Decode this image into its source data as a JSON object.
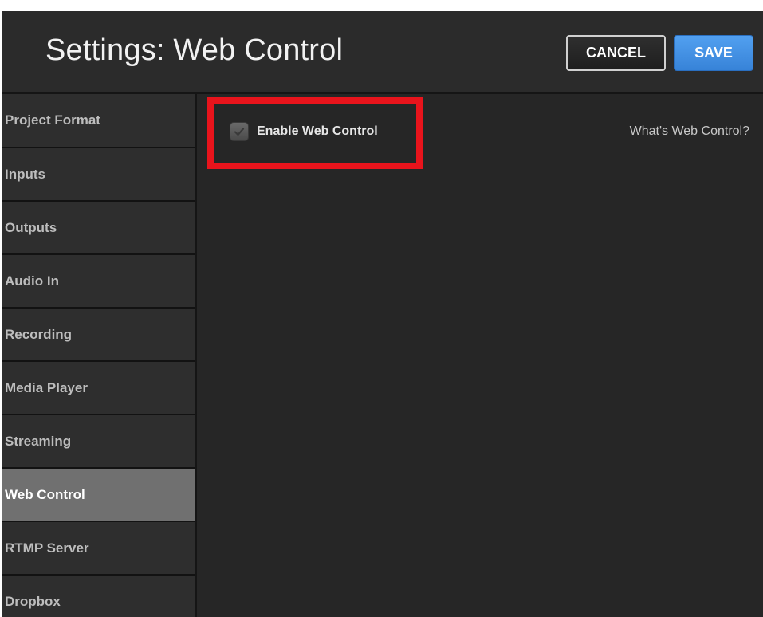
{
  "header": {
    "title": "Settings: Web Control",
    "cancel_label": "CANCEL",
    "save_label": "SAVE"
  },
  "sidebar": {
    "items": [
      {
        "label": "Project Format",
        "active": false
      },
      {
        "label": "Inputs",
        "active": false
      },
      {
        "label": "Outputs",
        "active": false
      },
      {
        "label": "Audio In",
        "active": false
      },
      {
        "label": "Recording",
        "active": false
      },
      {
        "label": "Media Player",
        "active": false
      },
      {
        "label": "Streaming",
        "active": false
      },
      {
        "label": "Web Control",
        "active": true
      },
      {
        "label": "RTMP Server",
        "active": false
      },
      {
        "label": "Dropbox",
        "active": false
      }
    ]
  },
  "content": {
    "enable_label": "Enable Web Control",
    "enable_checked": true,
    "help_link": "What's Web Control?"
  },
  "colors": {
    "save_blue": "#4592e6",
    "highlight_red": "#e8141c",
    "active_item": "#707070",
    "background": "#262626"
  },
  "icons": {
    "checkbox": "checkmark-icon"
  }
}
